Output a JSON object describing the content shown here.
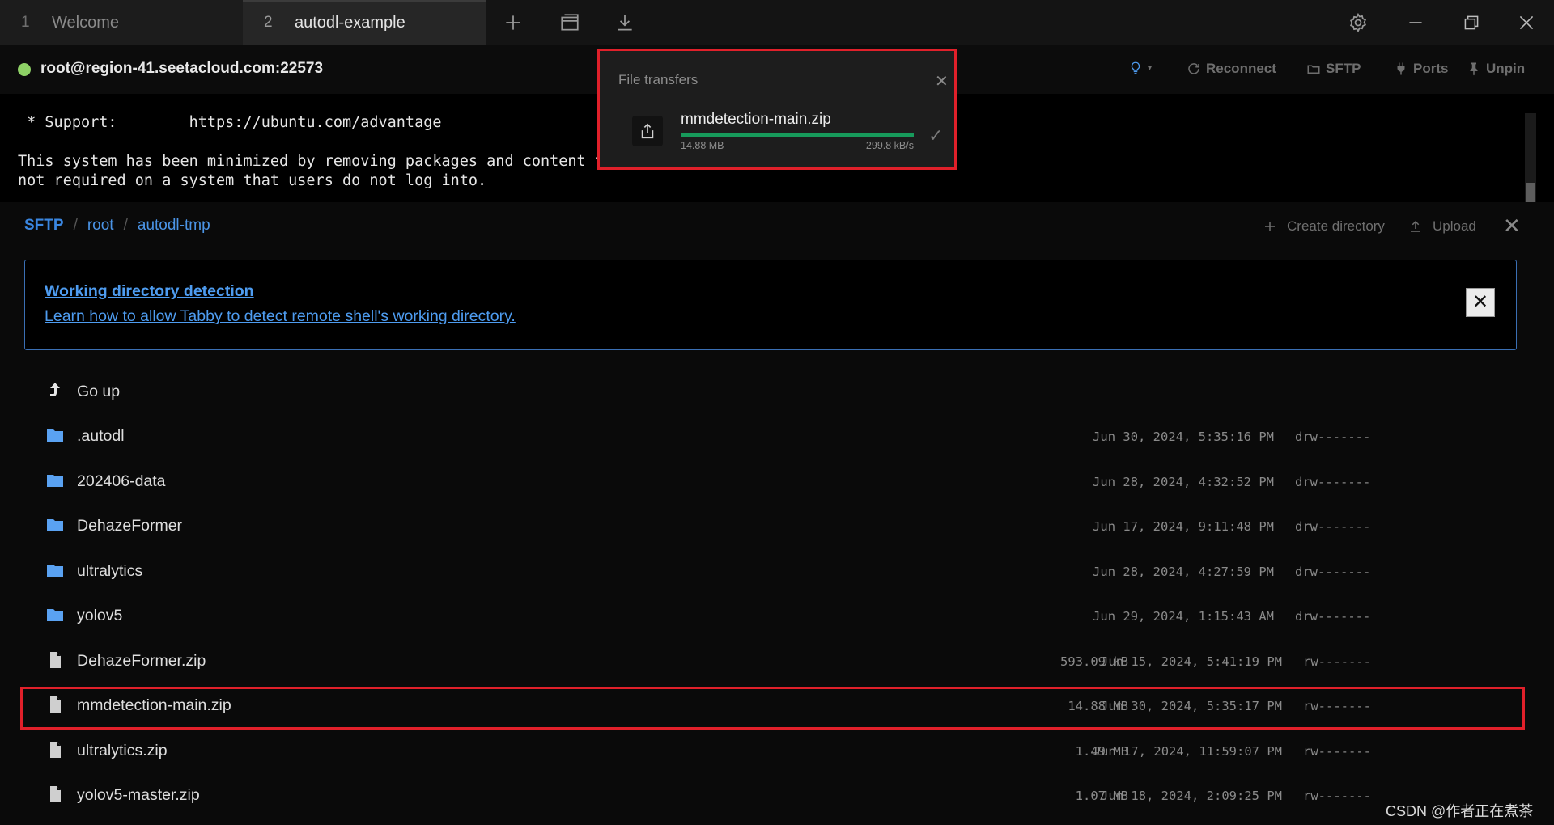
{
  "tabs": [
    {
      "number": "1",
      "label": "Welcome"
    },
    {
      "number": "2",
      "label": "autodl-example"
    }
  ],
  "titlebar_icons": [
    "plus-icon",
    "window-icon",
    "download-icon",
    "gear-icon",
    "minimize-icon",
    "restore-icon",
    "close-icon"
  ],
  "connection": {
    "host": "root@region-41.seetacloud.com:22573",
    "status_color": "#8ed166"
  },
  "terminal_toolbar": {
    "reconnect": "Reconnect",
    "sftp": "SFTP",
    "ports": "Ports",
    "unpin": "Unpin"
  },
  "terminal_lines": [
    " * Support:        https://ubuntu.com/advantage",
    "This system has been minimized by removing packages and content t",
    "not required on a system that users do not log into."
  ],
  "file_transfers": {
    "title": "File transfers",
    "item": {
      "name": "mmdetection-main.zip",
      "size": "14.88 MB",
      "speed": "299.8 kB/s",
      "progress_percent": 100
    }
  },
  "sftp": {
    "breadcrumb": [
      "SFTP",
      "root",
      "autodl-tmp"
    ],
    "create_directory": "Create directory",
    "upload": "Upload",
    "banner": {
      "title": "Working directory detection",
      "link": "Learn how to allow Tabby to detect remote shell's working directory.",
      "close": "✕"
    },
    "go_up": "Go up",
    "folders": [
      {
        "name": ".autodl",
        "date": "Jun 30, 2024, 5:35:16 PM",
        "mode": "drw-------"
      },
      {
        "name": "202406-data",
        "date": "Jun 28, 2024, 4:32:52 PM",
        "mode": "drw-------"
      },
      {
        "name": "DehazeFormer",
        "date": "Jun 17, 2024, 9:11:48 PM",
        "mode": "drw-------"
      },
      {
        "name": "ultralytics",
        "date": "Jun 28, 2024, 4:27:59 PM",
        "mode": "drw-------"
      },
      {
        "name": "yolov5",
        "date": "Jun 29, 2024, 1:15:43 AM",
        "mode": "drw-------"
      }
    ],
    "files": [
      {
        "name": "DehazeFormer.zip",
        "size": "593.09 kB",
        "date": "Jun 15, 2024, 5:41:19 PM",
        "mode": "rw-------"
      },
      {
        "name": "mmdetection-main.zip",
        "size": "14.88 MB",
        "date": "Jun 30, 2024, 5:35:17 PM",
        "mode": "rw-------"
      },
      {
        "name": "ultralytics.zip",
        "size": "1.49 MB",
        "date": "Jun 17, 2024, 11:59:07 PM",
        "mode": "rw-------"
      },
      {
        "name": "yolov5-master.zip",
        "size": "1.07 MB",
        "date": "Jun 18, 2024, 2:09:25 PM",
        "mode": "rw-------"
      }
    ]
  },
  "watermark": "CSDN @作者正在煮茶",
  "colors": {
    "accent_blue": "#4e9cf0",
    "folder_icon": "#5aa2f2",
    "highlight": "#e0202a",
    "progress": "#179a5b"
  }
}
